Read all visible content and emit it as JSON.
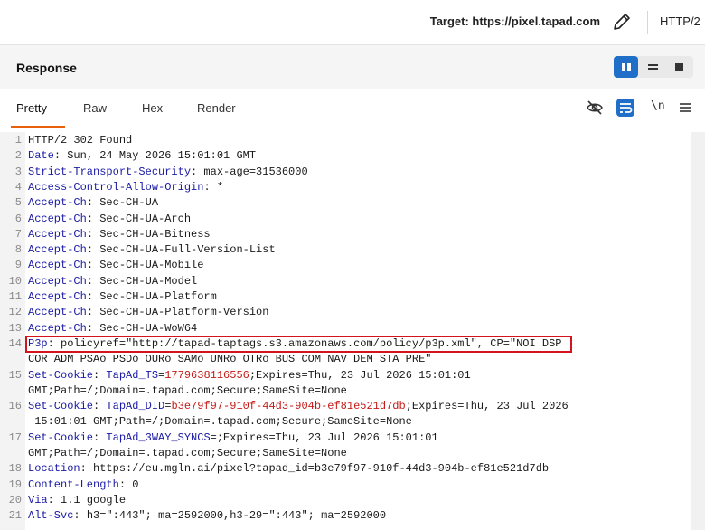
{
  "toolbar": {
    "target_label": "Target: https://pixel.tapad.com",
    "edit_icon": "pencil-icon",
    "http_version": "HTTP/2"
  },
  "response_panel": {
    "title": "Response",
    "layout_options": [
      "split-columns",
      "split-rows",
      "single"
    ],
    "active_layout": "split-columns"
  },
  "tabs": [
    {
      "label": "Pretty",
      "active": true
    },
    {
      "label": "Raw",
      "active": false
    },
    {
      "label": "Hex",
      "active": false
    },
    {
      "label": "Render",
      "active": false
    }
  ],
  "tools": {
    "icons": [
      "eye-off-icon",
      "wrap-lines-icon",
      "menu-icon"
    ],
    "newline_toggle": "\\n"
  },
  "colors": {
    "accent": "#1f6fc8",
    "tab_underline": "#e8600a",
    "header_name": "#1a1aa6",
    "cookie_value": "#c41a16",
    "highlight": "#d4141c"
  },
  "lines": [
    {
      "n": "1",
      "segments": [
        {
          "t": "HTTP/2 302 Found",
          "k": "plain"
        }
      ]
    },
    {
      "n": "2",
      "segments": [
        {
          "t": "Date",
          "k": "name"
        },
        {
          "t": ": Sun, 24 May 2026 15:01:01 GMT",
          "k": "plain"
        }
      ]
    },
    {
      "n": "3",
      "segments": [
        {
          "t": "Strict-Transport-Security",
          "k": "name"
        },
        {
          "t": ": max-age=31536000",
          "k": "plain"
        }
      ]
    },
    {
      "n": "4",
      "segments": [
        {
          "t": "Access-Control-Allow-Origin",
          "k": "name"
        },
        {
          "t": ": *",
          "k": "plain"
        }
      ]
    },
    {
      "n": "5",
      "segments": [
        {
          "t": "Accept-Ch",
          "k": "name"
        },
        {
          "t": ": Sec-CH-UA",
          "k": "plain"
        }
      ]
    },
    {
      "n": "6",
      "segments": [
        {
          "t": "Accept-Ch",
          "k": "name"
        },
        {
          "t": ": Sec-CH-UA-Arch",
          "k": "plain"
        }
      ]
    },
    {
      "n": "7",
      "segments": [
        {
          "t": "Accept-Ch",
          "k": "name"
        },
        {
          "t": ": Sec-CH-UA-Bitness",
          "k": "plain"
        }
      ]
    },
    {
      "n": "8",
      "segments": [
        {
          "t": "Accept-Ch",
          "k": "name"
        },
        {
          "t": ": Sec-CH-UA-Full-Version-List",
          "k": "plain"
        }
      ]
    },
    {
      "n": "9",
      "segments": [
        {
          "t": "Accept-Ch",
          "k": "name"
        },
        {
          "t": ": Sec-CH-UA-Mobile",
          "k": "plain"
        }
      ]
    },
    {
      "n": "10",
      "segments": [
        {
          "t": "Accept-Ch",
          "k": "name"
        },
        {
          "t": ": Sec-CH-UA-Model",
          "k": "plain"
        }
      ]
    },
    {
      "n": "11",
      "segments": [
        {
          "t": "Accept-Ch",
          "k": "name"
        },
        {
          "t": ": Sec-CH-UA-Platform",
          "k": "plain"
        }
      ]
    },
    {
      "n": "12",
      "segments": [
        {
          "t": "Accept-Ch",
          "k": "name"
        },
        {
          "t": ": Sec-CH-UA-Platform-Version",
          "k": "plain"
        }
      ]
    },
    {
      "n": "13",
      "segments": [
        {
          "t": "Accept-Ch",
          "k": "name"
        },
        {
          "t": ": Sec-CH-UA-WoW64",
          "k": "plain"
        }
      ]
    },
    {
      "n": "14",
      "segments": [
        {
          "t": "P3p",
          "k": "name"
        },
        {
          "t": ": policyref=\"http://tapad-taptags.s3.amazonaws.com/policy/p3p.xml\", CP=\"NOI DSP",
          "k": "plain"
        }
      ]
    },
    {
      "n": "",
      "segments": [
        {
          "t": "COR ADM PSAo PSDo OURo SAMo UNRo OTRo BUS COM NAV DEM STA PRE\"",
          "k": "plain"
        }
      ]
    },
    {
      "n": "15",
      "segments": [
        {
          "t": "Set-Cookie",
          "k": "name"
        },
        {
          "t": ": ",
          "k": "plain"
        },
        {
          "t": "TapAd_TS",
          "k": "name"
        },
        {
          "t": "=",
          "k": "plain"
        },
        {
          "t": "1779638116556",
          "k": "value"
        },
        {
          "t": ";Expires=Thu, 23 Jul 2026 15:01:01",
          "k": "plain"
        }
      ]
    },
    {
      "n": "",
      "segments": [
        {
          "t": "GMT;Path=/;Domain=.tapad.com;Secure;SameSite=None",
          "k": "plain"
        }
      ]
    },
    {
      "n": "16",
      "segments": [
        {
          "t": "Set-Cookie",
          "k": "name"
        },
        {
          "t": ": ",
          "k": "plain"
        },
        {
          "t": "TapAd_DID",
          "k": "name"
        },
        {
          "t": "=",
          "k": "plain"
        },
        {
          "t": "b3e79f97-910f-44d3-904b-ef81e521d7db",
          "k": "value"
        },
        {
          "t": ";Expires=Thu, 23 Jul 2026",
          "k": "plain"
        }
      ]
    },
    {
      "n": "",
      "segments": [
        {
          "t": " 15:01:01 GMT;Path=/;Domain=.tapad.com;Secure;SameSite=None",
          "k": "plain"
        }
      ]
    },
    {
      "n": "17",
      "segments": [
        {
          "t": "Set-Cookie",
          "k": "name"
        },
        {
          "t": ": ",
          "k": "plain"
        },
        {
          "t": "TapAd_3WAY_SYNCS",
          "k": "name"
        },
        {
          "t": "=;Expires=Thu, 23 Jul 2026 15:01:01",
          "k": "plain"
        }
      ]
    },
    {
      "n": "",
      "segments": [
        {
          "t": "GMT;Path=/;Domain=.tapad.com;Secure;SameSite=None",
          "k": "plain"
        }
      ]
    },
    {
      "n": "18",
      "segments": [
        {
          "t": "Location",
          "k": "name"
        },
        {
          "t": ": https://eu.mgln.ai/pixel?tapad_id=b3e79f97-910f-44d3-904b-ef81e521d7db",
          "k": "plain"
        }
      ]
    },
    {
      "n": "19",
      "segments": [
        {
          "t": "Content-Length",
          "k": "name"
        },
        {
          "t": ": 0",
          "k": "plain"
        }
      ]
    },
    {
      "n": "20",
      "segments": [
        {
          "t": "Via",
          "k": "name"
        },
        {
          "t": ": 1.1 google",
          "k": "plain"
        }
      ]
    },
    {
      "n": "21",
      "segments": [
        {
          "t": "Alt-Svc",
          "k": "name"
        },
        {
          "t": ": h3=\":443\"; ma=2592000,h3-29=\":443\"; ma=2592000",
          "k": "plain"
        }
      ]
    }
  ],
  "highlight": {
    "line": "14",
    "note_text": "P3p: policyref=\"http://tapad-taptags.s3.amazonaws.com/policy/p3p.xml\""
  }
}
